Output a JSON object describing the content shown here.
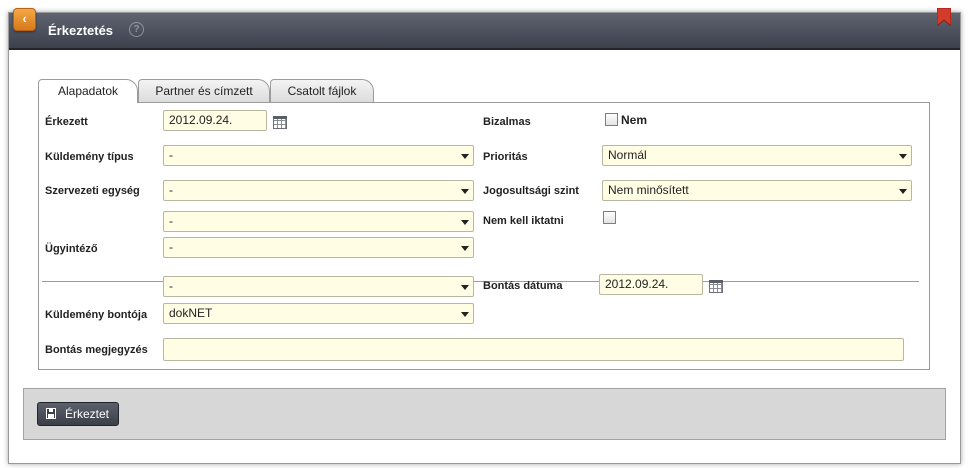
{
  "window": {
    "title": "Érkeztetés",
    "help_icon": "question-circle-icon",
    "back_icon": "chevron-left-icon",
    "bookmark_icon": "bookmark-icon",
    "accent_orange": "#e68a2a",
    "bookmark_red": "#d43a2a"
  },
  "tabs": [
    {
      "label": "Alapadatok",
      "active": true
    },
    {
      "label": "Partner és címzett",
      "active": false
    },
    {
      "label": "Csatolt fájlok",
      "active": false
    }
  ],
  "form": {
    "erkezett": {
      "label": "Érkezett",
      "value": "2012.09.24."
    },
    "kuldemeny_tipus": {
      "label": "Küldemény típus",
      "value": "-"
    },
    "szervezeti_egyseg": {
      "label": "Szervezeti egység",
      "value": "-"
    },
    "extra_select": {
      "value": "-"
    },
    "ugyintezo": {
      "label": "Ügyintéző",
      "value": "-"
    },
    "bizalmas": {
      "label": "Bizalmas",
      "checkbox_text": "Nem",
      "checked": false
    },
    "prioritas": {
      "label": "Prioritás",
      "value": "Normál"
    },
    "jogosultsagi_szint": {
      "label": "Jogosultsági szint",
      "value": "Nem minősített"
    },
    "nem_kell_iktatni": {
      "label": "Nem kell iktatni",
      "checked": false
    },
    "bonto_select": {
      "value": "-"
    },
    "kuldemeny_bontoja": {
      "label": "Küldemény bontója",
      "value": "dokNET"
    },
    "bontas_datuma": {
      "label": "Bontás dátuma",
      "value": "2012.09.24."
    },
    "bontas_megjegyzes": {
      "label": "Bontás megjegyzés",
      "value": ""
    }
  },
  "footer": {
    "submit_label": "Érkeztet",
    "submit_icon": "save-icon"
  },
  "colors": {
    "field_background": "#fffde4",
    "titlebar": "#4a4f5a",
    "footer": "#d7d7d7"
  }
}
